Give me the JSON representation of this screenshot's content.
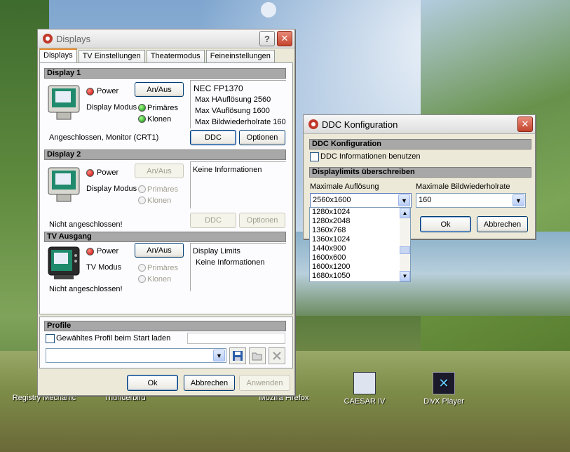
{
  "desktop": {
    "icons": [
      {
        "label": "Registry Mechanic",
        "icon": "registry-mechanic-icon"
      },
      {
        "label": "Thunderbird",
        "icon": "thunderbird-icon"
      },
      {
        "label": "Mozilla Firefox",
        "icon": "firefox-icon"
      },
      {
        "label": "CAESAR IV",
        "icon": "caesar-iv-icon"
      },
      {
        "label": "DivX Player",
        "icon": "divx-player-icon"
      }
    ]
  },
  "displays_window": {
    "title": "Displays",
    "help_button": "?",
    "close_button": "✕",
    "tabs": [
      "Displays",
      "TV Einstellungen",
      "Theatermodus",
      "Feineinstellungen"
    ],
    "display1": {
      "header": "Display 1",
      "power_label": "Power",
      "toggle_button": "An/Aus",
      "mode_label": "Display Modus",
      "primary_label": "Primäres",
      "clone_label": "Klonen",
      "status": "Angeschlossen, Monitor (CRT1)",
      "info": [
        "NEC FP1370",
        "Max HAuflösung 2560",
        "Max VAuflösung 1600",
        "Max Bildwiederholrate 160"
      ],
      "ddc_button": "DDC",
      "options_button": "Optionen"
    },
    "display2": {
      "header": "Display 2",
      "power_label": "Power",
      "toggle_button": "An/Aus",
      "mode_label": "Display Modus",
      "primary_label": "Primäres",
      "clone_label": "Klonen",
      "status": "Nicht angeschlossen!",
      "info": [
        "Keine Informationen"
      ],
      "ddc_button": "DDC",
      "options_button": "Optionen"
    },
    "tv": {
      "header": "TV Ausgang",
      "power_label": "Power",
      "toggle_button": "An/Aus",
      "mode_label": "TV Modus",
      "primary_label": "Primäres",
      "clone_label": "Klonen",
      "status": "Nicht angeschlossen!",
      "info": [
        "Display Limits",
        "Keine Informationen"
      ]
    },
    "profile": {
      "header": "Profile",
      "checkbox_label": "Gewähltes Profil beim Start laden",
      "profile_value": ""
    },
    "buttons": {
      "ok": "Ok",
      "cancel": "Abbrechen",
      "apply": "Anwenden"
    }
  },
  "ddc_window": {
    "title": "DDC Konfiguration",
    "close_button": "✕",
    "section1": "DDC Konfiguration",
    "use_ddc_label": "DDC Informationen benutzen",
    "section2": "Displaylimits überschreiben",
    "max_res_label": "Maximale Auflösung",
    "max_res_value": "2560x1600",
    "max_refresh_label": "Maximale Bildwiederholrate",
    "max_refresh_value": "160",
    "ok_button": "Ok",
    "cancel_button": "Abbrechen",
    "dropdown_options": [
      "1280x1024",
      "1280x2048",
      "1360x768",
      "1360x1024",
      "1440x900",
      "1600x600",
      "1600x1200",
      "1680x1050"
    ]
  },
  "colors": {
    "accent": "#e68b2c",
    "window_bg": "#ece9d8",
    "section_header": "#a8a8a8"
  }
}
